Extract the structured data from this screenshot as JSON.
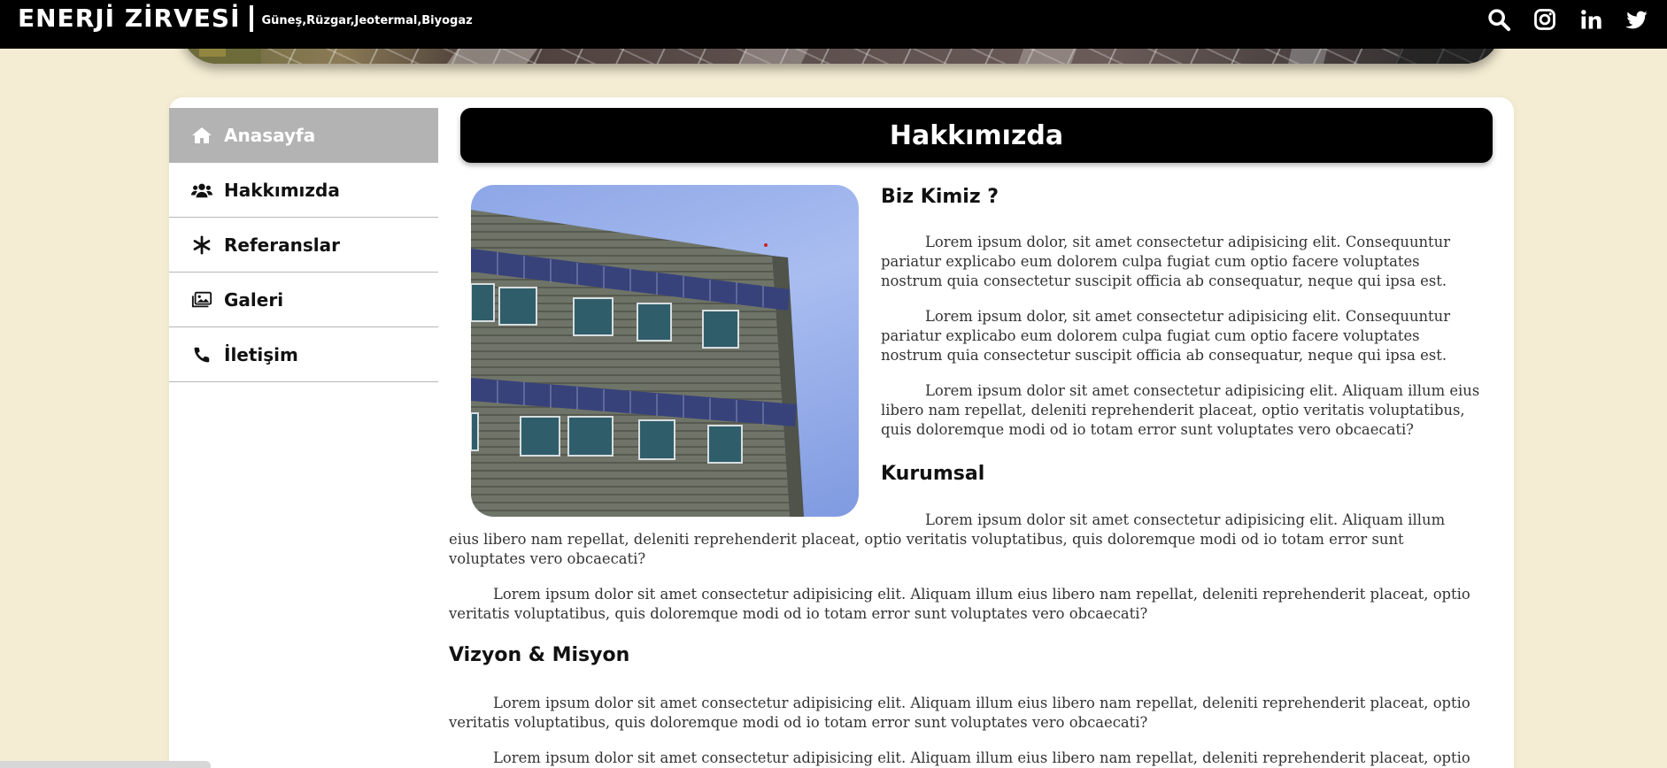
{
  "brand": {
    "title": "ENERJİ ZİRVESİ",
    "subtitle": "Güneş,Rüzgar,Jeotermal,Biyogaz"
  },
  "top_icons": [
    "search-icon",
    "instagram-icon",
    "linkedin-icon",
    "twitter-icon"
  ],
  "sidebar": {
    "items": [
      {
        "label": "Anasayfa",
        "icon": "home-icon",
        "active": true
      },
      {
        "label": "Hakkımızda",
        "icon": "users-icon",
        "active": false
      },
      {
        "label": "Referanslar",
        "icon": "asterisk-icon",
        "active": false
      },
      {
        "label": "Galeri",
        "icon": "images-icon",
        "active": false
      },
      {
        "label": "İletişim",
        "icon": "phone-icon",
        "active": false
      }
    ]
  },
  "page": {
    "title": "Hakkımızda",
    "sections": {
      "biz_kimiz": {
        "heading": "Biz Kimiz ?",
        "paragraphs": [
          "Lorem ipsum dolor, sit amet consectetur adipisicing elit. Consequuntur pariatur explicabo eum dolorem culpa fugiat cum optio facere voluptates nostrum quia consectetur suscipit officia ab consequatur, neque qui ipsa est.",
          "Lorem ipsum dolor, sit amet consectetur adipisicing elit. Consequuntur pariatur explicabo eum dolorem culpa fugiat cum optio facere voluptates nostrum quia consectetur suscipit officia ab consequatur, neque qui ipsa est.",
          "Lorem ipsum dolor sit amet consectetur adipisicing elit. Aliquam illum eius libero nam repellat, deleniti reprehenderit placeat, optio veritatis voluptatibus, quis doloremque modi od io totam error sunt voluptates vero obcaecati?"
        ]
      },
      "kurumsal": {
        "heading": "Kurumsal",
        "paragraphs": [
          "Lorem ipsum dolor sit amet consectetur adipisicing elit. Aliquam illum eius libero nam repellat, deleniti reprehenderit placeat, optio veritatis voluptatibus, quis doloremque modi od io totam error sunt voluptates vero obcaecati?",
          "Lorem ipsum dolor sit amet consectetur adipisicing elit. Aliquam illum eius libero nam repellat, deleniti reprehenderit placeat, optio veritatis voluptatibus, quis doloremque modi od io totam error sunt voluptates vero obcaecati?"
        ]
      },
      "vizyon": {
        "heading": "Vizyon & Misyon",
        "paragraphs": [
          "Lorem ipsum dolor sit amet consectetur adipisicing elit. Aliquam illum eius libero nam repellat, deleniti reprehenderit placeat, optio veritatis voluptatibus, quis doloremque modi od io totam error sunt voluptates vero obcaecati?",
          "Lorem ipsum dolor sit amet consectetur adipisicing elit. Aliquam illum eius libero nam repellat, deleniti reprehenderit placeat, optio"
        ]
      }
    }
  },
  "colors": {
    "background": "#f5edd3",
    "topbar": "#000000",
    "active_nav": "#b3b3b3",
    "text": "#333333"
  }
}
